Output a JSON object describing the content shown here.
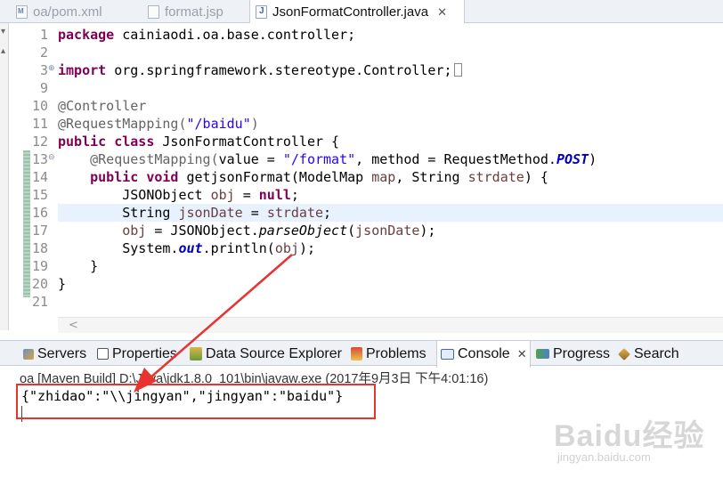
{
  "editor_tabs": [
    {
      "label": "oa/pom.xml",
      "icon": "maven-file-icon",
      "active": false
    },
    {
      "label": "format.jsp",
      "icon": "jsp-file-icon",
      "active": false
    },
    {
      "label": "JsonFormatController.java",
      "icon": "java-file-icon",
      "active": true,
      "close": "✕"
    }
  ],
  "line_numbers": [
    "1",
    "2",
    "3",
    "9",
    "10",
    "11",
    "12",
    "13",
    "14",
    "15",
    "16",
    "17",
    "18",
    "19",
    "20",
    "21"
  ],
  "code": {
    "l1": {
      "kw": "package",
      "rest": " cainiaodi.oa.base.controller;"
    },
    "l3": {
      "kw": "import",
      "rest": " org.springframework.stereotype.Controller;"
    },
    "l10": {
      "ann": "@Controller"
    },
    "l11": {
      "ann": "@RequestMapping(",
      "str": "\"/baidu\"",
      "end": ")"
    },
    "l12": {
      "kw1": "public",
      "kw2": "class",
      "rest": " JsonFormatController {"
    },
    "l13": {
      "ann": "@RequestMapping(",
      "p1": "value = ",
      "str": "\"/format\"",
      "p2": ", method = RequestMethod.",
      "fld": "POST",
      "end": ")"
    },
    "l14": {
      "kw1": "public",
      "kw2": "void",
      "p1": " getjsonFormat(ModelMap ",
      "v1": "map",
      "p2": ", String ",
      "v2": "strdate",
      "end": ") {"
    },
    "l15": {
      "p1": "JSONObject ",
      "v1": "obj",
      "p2": " = ",
      "kw": "null",
      "end": ";"
    },
    "l16": {
      "p1": "String ",
      "v1": "jsonDate",
      "p2": " = ",
      "v2": "strdate",
      "end": ";"
    },
    "l17": {
      "v1": "obj",
      "p1": " = JSONObject.",
      "st": "parseObject",
      "p2": "(",
      "v2": "jsonDate",
      "end": ");"
    },
    "l18": {
      "p1": "System.",
      "fld": "out",
      "p2": ".println(",
      "v1": "obj",
      "end": ");"
    },
    "l19": {
      "text": "}"
    },
    "l20": {
      "text": "}"
    }
  },
  "view_tabs": [
    {
      "label": "Servers",
      "icon": "servers-icon"
    },
    {
      "label": "Properties",
      "icon": "properties-icon"
    },
    {
      "label": "Data Source Explorer",
      "icon": "data-source-explorer-icon"
    },
    {
      "label": "Problems",
      "icon": "problems-icon"
    },
    {
      "label": "Console",
      "icon": "console-icon",
      "active": true,
      "close": "✕"
    },
    {
      "label": "Progress",
      "icon": "progress-icon"
    },
    {
      "label": "Search",
      "icon": "search-icon"
    }
  ],
  "console": {
    "title": "oa [Maven Build] D:\\Java\\jdk1.8.0_101\\bin\\javaw.exe (2017年9月3日 下午4:01:16)",
    "output": "{\"zhidao\":\"\\\\jingyan\",\"jingyan\":\"baidu\"}"
  },
  "watermark": {
    "main": "Baidu经验",
    "sub": "jingyan.baidu.com"
  },
  "colors": {
    "annotation_red": "#e8332f",
    "keyword": "#7f0055",
    "string": "#2a00ff",
    "field": "#0000c0"
  }
}
